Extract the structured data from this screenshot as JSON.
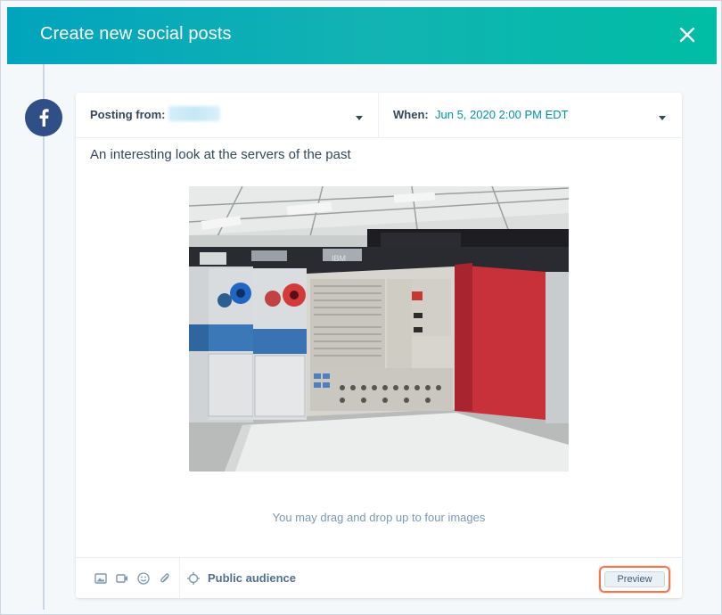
{
  "header": {
    "title": "Create new social posts",
    "close_icon": "close-icon"
  },
  "network": {
    "icon": "facebook-icon",
    "color": "#2f4f86"
  },
  "post": {
    "posting_from_label": "Posting from:",
    "when_label": "When:",
    "when_value": "Jun 5, 2020 2:00 PM EDT",
    "text": "An interesting look at the servers of the past",
    "image_icon": "ibm-mainframe-photo",
    "drag_hint": "You may drag and drop up to four images"
  },
  "toolbar": {
    "icons": [
      "image-icon",
      "video-icon",
      "emoji-icon",
      "attachment-icon"
    ],
    "audience_label": "Public audience",
    "preview_label": "Preview"
  },
  "colors": {
    "header_start": "#00a4bd",
    "header_end": "#00bda5",
    "link": "#0091ae",
    "highlight": "#ee7a53"
  }
}
